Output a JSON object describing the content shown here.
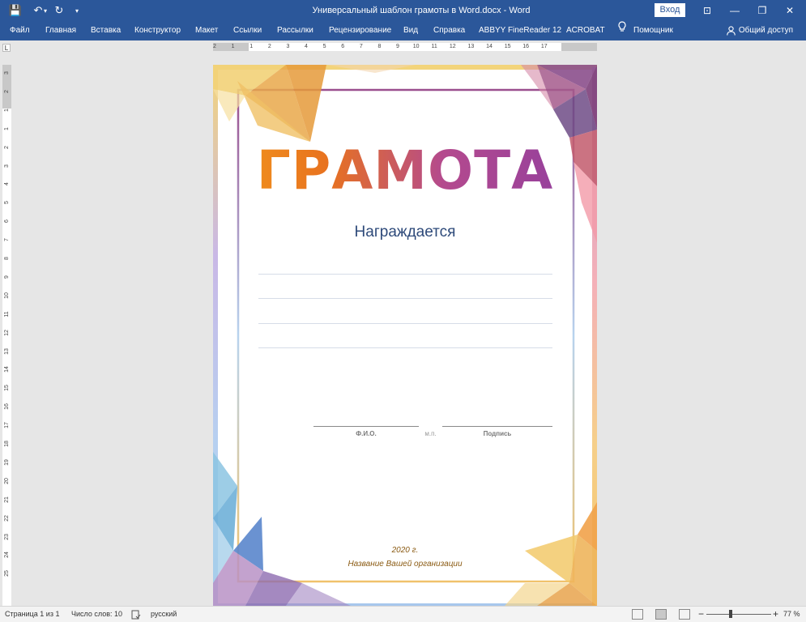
{
  "window": {
    "title": "Универсальный шаблон грамоты в Word.docx  -  Word",
    "login_label": "Вход",
    "minimize_icon": "—",
    "restore_icon": "❐",
    "close_icon": "✕",
    "ribbon_display_icon": "⊡"
  },
  "quick_access": {
    "save_icon": "💾",
    "undo_icon": "↶",
    "undo_more": "▾",
    "redo_icon": "↻",
    "customize_icon": "▾"
  },
  "ribbon": {
    "tabs": [
      "Файл",
      "Главная",
      "Вставка",
      "Конструктор",
      "Макет",
      "Ссылки",
      "Рассылки",
      "Рецензирование",
      "Вид",
      "Справка",
      "ABBYY FineReader 12",
      "ACROBAT"
    ],
    "tell_me_label": "Помощник",
    "share_label": "Общий доступ"
  },
  "ruler": {
    "corner": "L",
    "h_numbers": [
      "2",
      "1",
      "1",
      "2",
      "3",
      "4",
      "5",
      "6",
      "7",
      "8",
      "9",
      "10",
      "11",
      "12",
      "13",
      "14",
      "15",
      "16",
      "17"
    ],
    "v_numbers": [
      "3",
      "2",
      "1",
      "1",
      "2",
      "3",
      "4",
      "5",
      "6",
      "7",
      "8",
      "9",
      "10",
      "11",
      "12",
      "13",
      "14",
      "15",
      "16",
      "17",
      "18",
      "19",
      "20",
      "21",
      "22",
      "23",
      "24",
      "25"
    ]
  },
  "document": {
    "heading": "ГРАМОТА",
    "awarded": "Награждается",
    "fio_label": "Ф.И.О.",
    "stamp_label": "м.п.",
    "signature_label": "Подпись",
    "year": "2020 г.",
    "organization": "Название Вашей организации"
  },
  "statusbar": {
    "page": "Страница 1 из 1",
    "words": "Число слов: 10",
    "language": "русский",
    "zoom_minus": "−",
    "zoom_plus": "+",
    "zoom": "77 %"
  },
  "colors": {
    "title_bar": "#2b579a",
    "heading_gradient_start": "#f39a1c",
    "heading_gradient_end": "#8d3da0",
    "awarded_text": "#2e4a7a",
    "footer_text": "#8a5a12"
  }
}
